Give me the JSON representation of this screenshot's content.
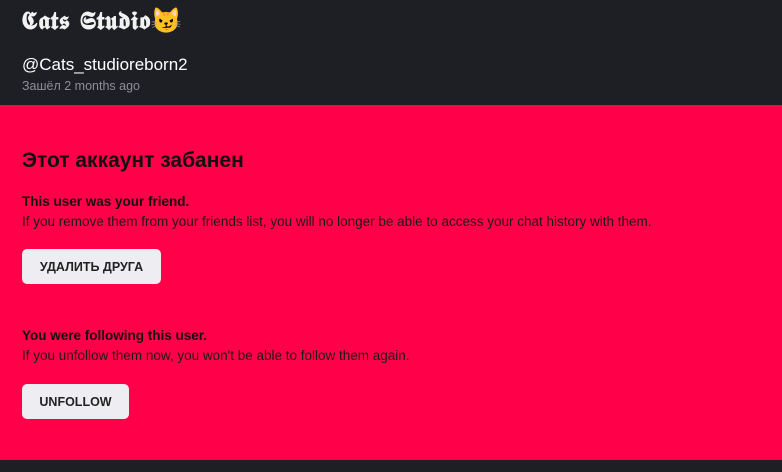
{
  "profile": {
    "display_name": "𝕮𝖆𝖙𝖘 𝕾𝖙𝖚𝖉𝖎𝖔😼",
    "username": "@Cats_studioreborn2",
    "last_seen": "Зашёл 2 months ago"
  },
  "ban_notice": {
    "title": "Этот аккаунт забанен",
    "friend_section": {
      "title": "This user was your friend.",
      "text": "If you remove them from your friends list, you will no longer be able to access your chat history with them.",
      "button_label": "УДАЛИТЬ ДРУГА"
    },
    "follow_section": {
      "title": "You were following this user.",
      "text": "If you unfollow them now, you won't be able to follow them again.",
      "button_label": "UNFOLLOW"
    }
  },
  "colors": {
    "header_bg": "#1e1f25",
    "ban_bg": "#ff0049",
    "button_bg": "#eeeef2"
  }
}
